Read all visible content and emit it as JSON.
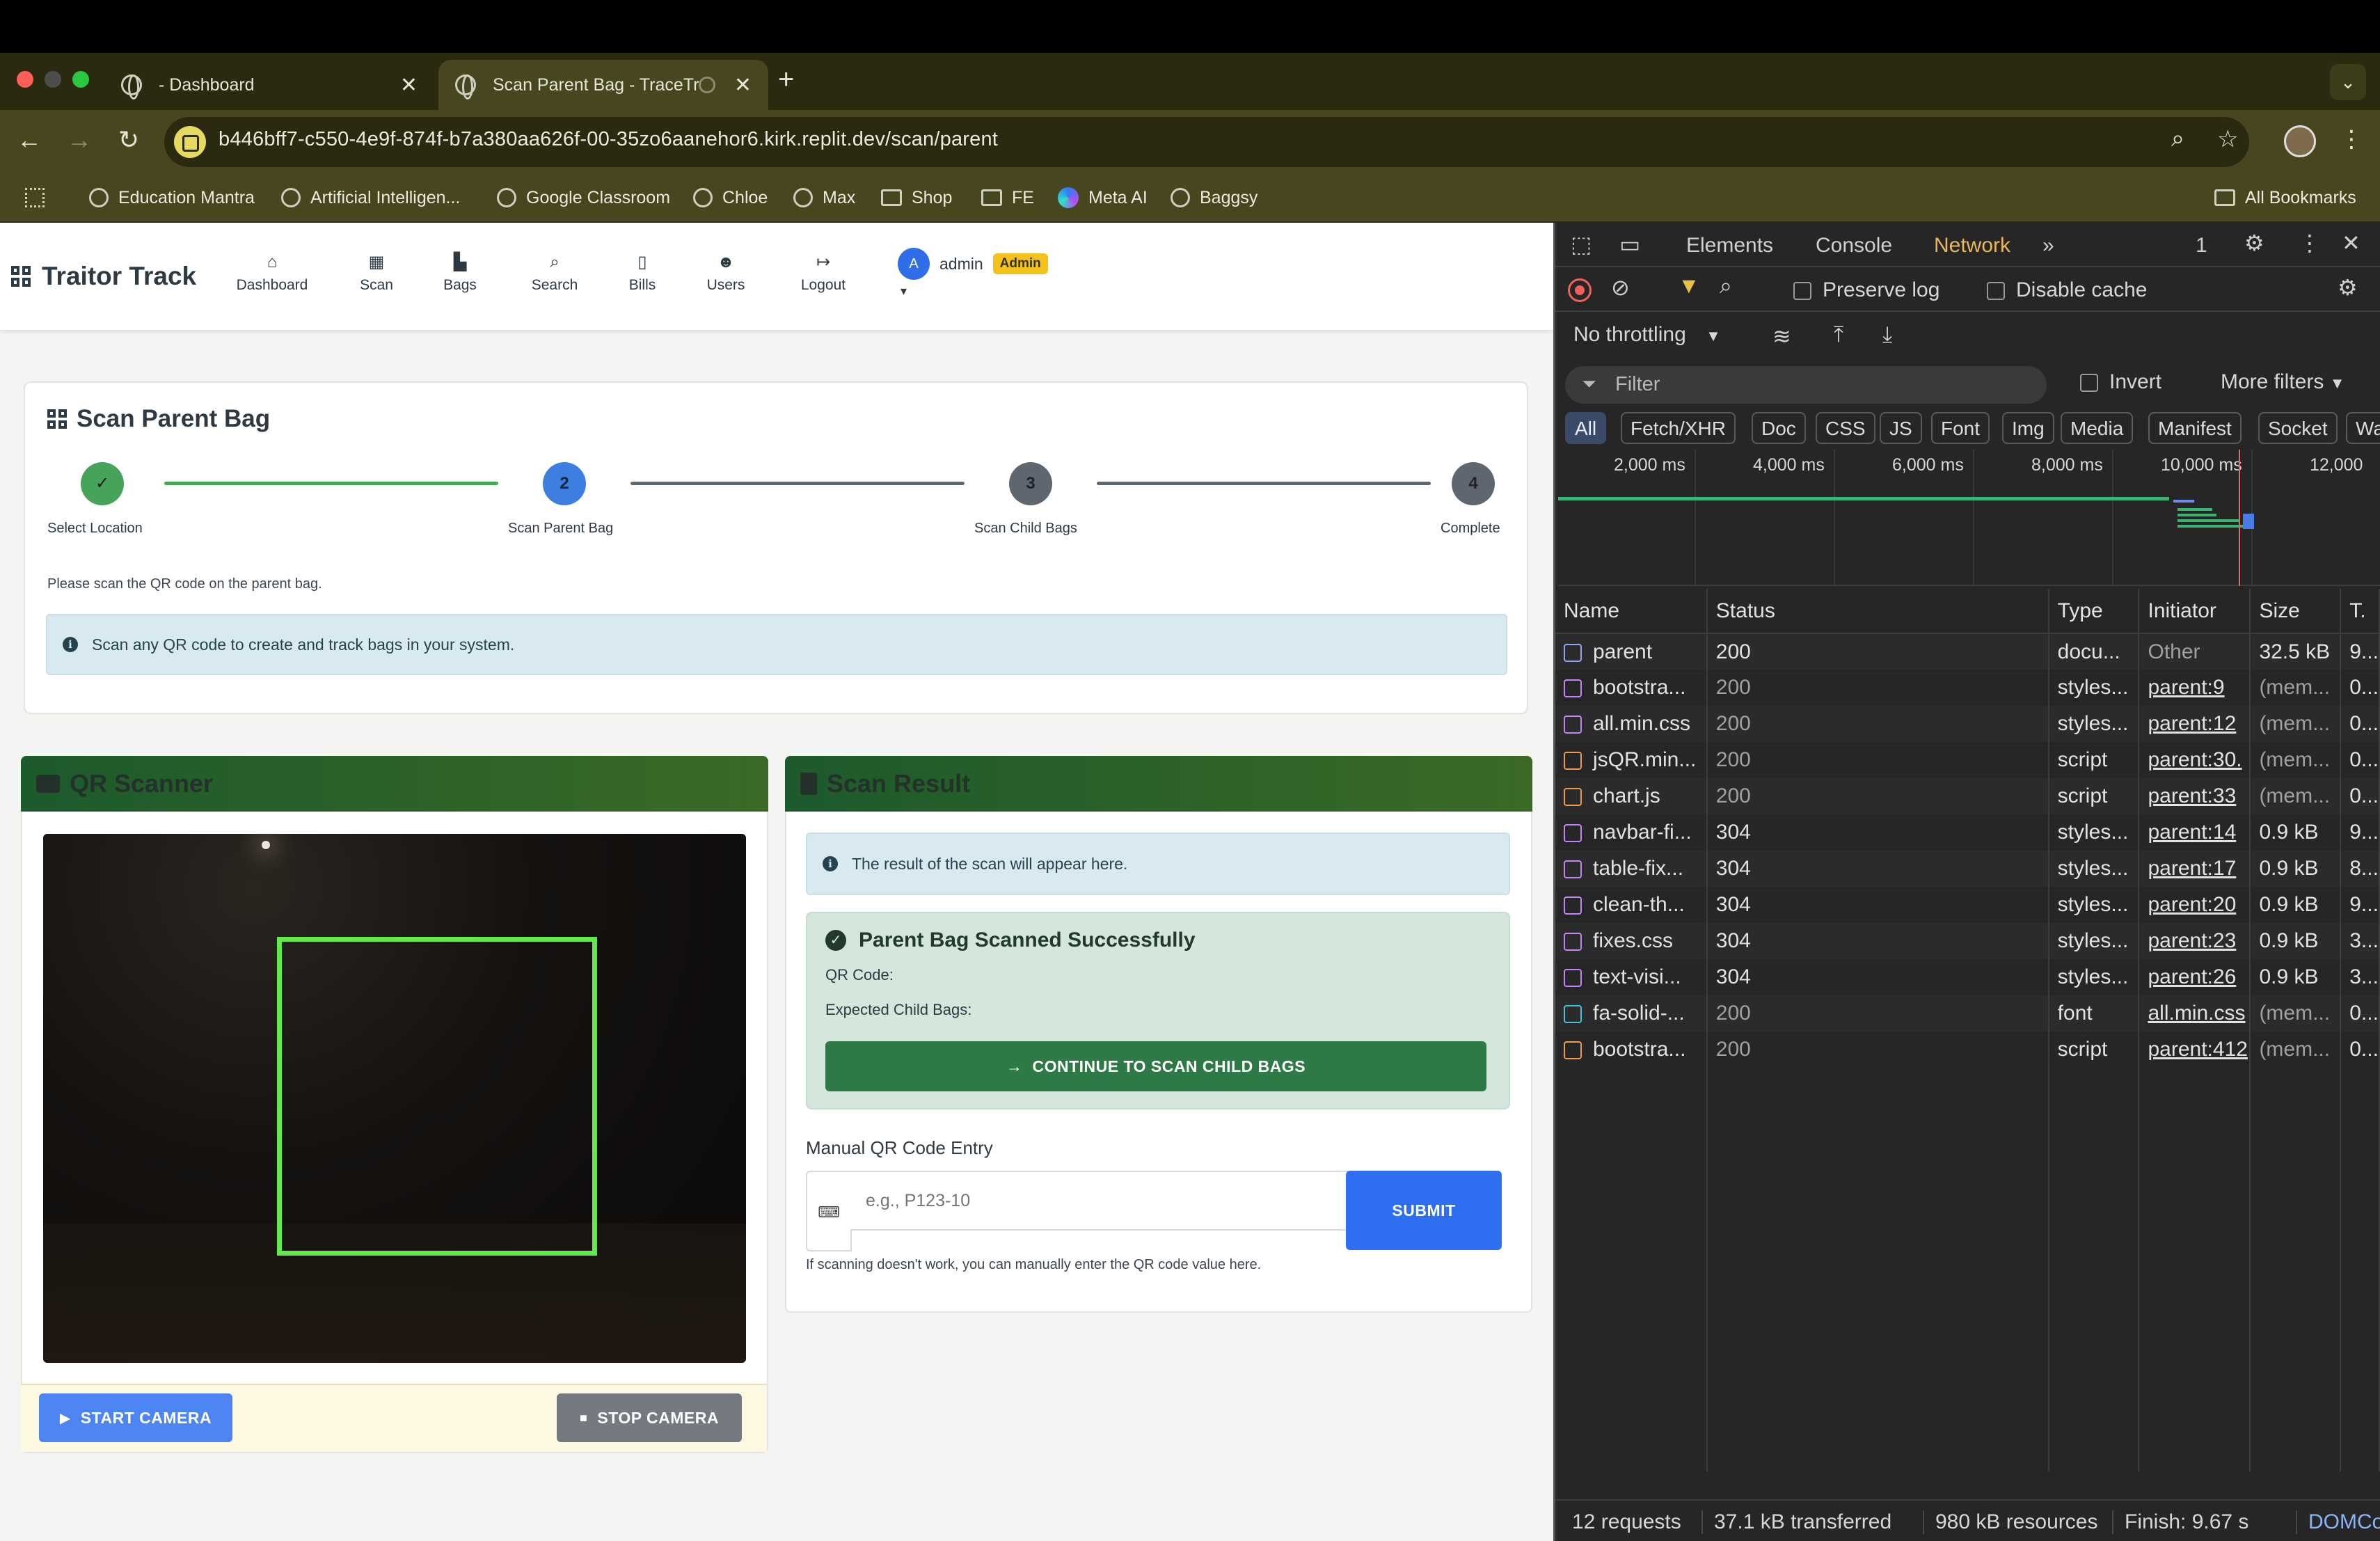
{
  "browser": {
    "tabs": [
      {
        "title": "- Dashboard"
      },
      {
        "title": "Scan Parent Bag - TraceTr"
      }
    ],
    "url": "b446bff7-c550-4e9f-874f-b7a380aa626f-00-35zo6aanehor6.kirk.replit.dev/scan/parent",
    "bookmarks": [
      "Education Mantra",
      "Artificial Intelligen...",
      "Google Classroom",
      "Chloe",
      "Max",
      "Shop",
      "FE",
      "Meta AI",
      "Baggsy"
    ],
    "all_bookmarks": "All Bookmarks"
  },
  "app": {
    "brand": "Traitor Track",
    "nav": [
      "Dashboard",
      "Scan",
      "Bags",
      "Search",
      "Bills",
      "Users",
      "Logout"
    ],
    "user": {
      "initial": "A",
      "name": "admin",
      "role": "Admin"
    }
  },
  "scan_card": {
    "title": "Scan Parent Bag",
    "steps": [
      {
        "num": "✓",
        "label": "Select Location"
      },
      {
        "num": "2",
        "label": "Scan Parent Bag"
      },
      {
        "num": "3",
        "label": "Scan Child Bags"
      },
      {
        "num": "4",
        "label": "Complete"
      }
    ],
    "hint": "Please scan the QR code on the parent bag.",
    "info": "Scan any QR code to create and track bags in your system."
  },
  "scanner": {
    "title": "QR Scanner",
    "start_label": "START CAMERA",
    "stop_label": "STOP CAMERA"
  },
  "result": {
    "title": "Scan Result",
    "info": "The result of the scan will appear here.",
    "success_title": "Parent Bag Scanned Successfully",
    "qr_code_label": "QR Code:",
    "expected_label": "Expected Child Bags:",
    "continue_label": "CONTINUE TO SCAN CHILD BAGS",
    "manual_label": "Manual QR Code Entry",
    "input_placeholder": "e.g., P123-10",
    "submit_label": "SUBMIT",
    "manual_help": "If scanning doesn't work, you can manually enter the QR code value here."
  },
  "devtools": {
    "tabs": [
      "Elements",
      "Console",
      "Network"
    ],
    "active_tab": "Network",
    "issues_count": "1",
    "preserve_log": "Preserve log",
    "disable_cache": "Disable cache",
    "throttling": "No throttling",
    "filter_placeholder": "Filter",
    "invert": "Invert",
    "more_filters": "More filters",
    "type_filters": [
      "All",
      "Fetch/XHR",
      "Doc",
      "CSS",
      "JS",
      "Font",
      "Img",
      "Media",
      "Manifest",
      "Socket",
      "Wa"
    ],
    "timeline_ticks": [
      "2,000 ms",
      "4,000 ms",
      "6,000 ms",
      "8,000 ms",
      "10,000 ms",
      "12,000"
    ],
    "columns": [
      "Name",
      "Status",
      "Type",
      "Initiator",
      "Size",
      "T."
    ],
    "rows": [
      {
        "name": "parent",
        "status": "200",
        "type": "docu...",
        "initiator": "Other",
        "size": "32.5 kB",
        "time": "9...",
        "kind": "doc"
      },
      {
        "name": "bootstra...",
        "status": "200",
        "type": "styles...",
        "initiator": "parent:9",
        "size": "(mem...",
        "time": "0...",
        "kind": "css"
      },
      {
        "name": "all.min.css",
        "status": "200",
        "type": "styles...",
        "initiator": "parent:12",
        "size": "(mem...",
        "time": "0...",
        "kind": "css"
      },
      {
        "name": "jsQR.min...",
        "status": "200",
        "type": "script",
        "initiator": "parent:30.",
        "size": "(mem...",
        "time": "0...",
        "kind": "js"
      },
      {
        "name": "chart.js",
        "status": "200",
        "type": "script",
        "initiator": "parent:33",
        "size": "(mem...",
        "time": "0...",
        "kind": "js"
      },
      {
        "name": "navbar-fi...",
        "status": "304",
        "type": "styles...",
        "initiator": "parent:14",
        "size": "0.9 kB",
        "time": "9...",
        "kind": "css"
      },
      {
        "name": "table-fix...",
        "status": "304",
        "type": "styles...",
        "initiator": "parent:17",
        "size": "0.9 kB",
        "time": "8...",
        "kind": "css"
      },
      {
        "name": "clean-th...",
        "status": "304",
        "type": "styles...",
        "initiator": "parent:20",
        "size": "0.9 kB",
        "time": "9...",
        "kind": "css"
      },
      {
        "name": "fixes.css",
        "status": "304",
        "type": "styles...",
        "initiator": "parent:23",
        "size": "0.9 kB",
        "time": "3...",
        "kind": "css"
      },
      {
        "name": "text-visi...",
        "status": "304",
        "type": "styles...",
        "initiator": "parent:26",
        "size": "0.9 kB",
        "time": "3...",
        "kind": "css"
      },
      {
        "name": "fa-solid-...",
        "status": "200",
        "type": "font",
        "initiator": "all.min.css",
        "size": "(mem...",
        "time": "0...",
        "kind": "font"
      },
      {
        "name": "bootstra...",
        "status": "200",
        "type": "script",
        "initiator": "parent:412",
        "size": "(mem...",
        "time": "0...",
        "kind": "js"
      }
    ],
    "summary": {
      "requests": "12 requests",
      "transferred": "37.1 kB transferred",
      "resources": "980 kB resources",
      "finish": "Finish: 9.67 s",
      "dom": "DOMCo"
    }
  }
}
